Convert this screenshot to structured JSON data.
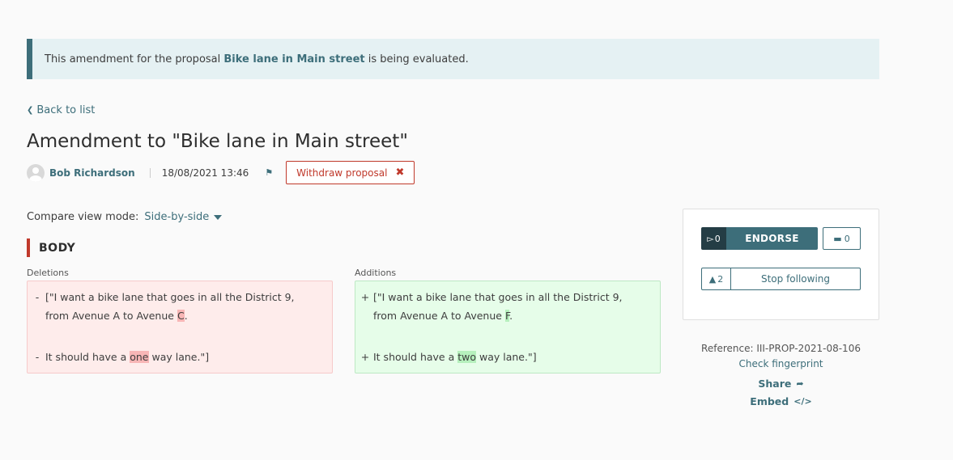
{
  "callout": {
    "prefix": "This amendment for the proposal",
    "proposal_link": "Bike lane in Main street",
    "suffix": "is being evaluated."
  },
  "nav": {
    "back_label": "Back to list"
  },
  "title": "Amendment to \"Bike lane in Main street\"",
  "meta": {
    "author": "Bob Richardson",
    "date": "18/08/2021 13:46",
    "withdraw_label": "Withdraw proposal"
  },
  "compare": {
    "label": "Compare view mode:",
    "selected": "Side-by-side"
  },
  "section": {
    "title": "BODY"
  },
  "diff": {
    "deletions_label": "Deletions",
    "additions_label": "Additions",
    "deletions": [
      {
        "sign": "-",
        "pre": "[\"I want a bike lane that goes in all the District 9, from Avenue A to Avenue ",
        "hl": "C",
        "post": "."
      },
      {
        "sign": "-",
        "pre": "It should have a ",
        "hl": "one",
        "post": " way lane.\"]"
      }
    ],
    "additions": [
      {
        "sign": "+",
        "pre": "[\"I want a bike lane that goes in all the District 9, from Avenue A to Avenue ",
        "hl": "F",
        "post": "."
      },
      {
        "sign": "+",
        "pre": "It should have a ",
        "hl": "two",
        "post": " way lane.\"]"
      }
    ]
  },
  "sidebar": {
    "endorse_count": "0",
    "endorse_label": "ENDORSE",
    "comments_count": "0",
    "followers_count": "2",
    "follow_label": "Stop following",
    "reference": "Reference: III-PROP-2021-08-106",
    "fingerprint_label": "Check fingerprint",
    "share_label": "Share",
    "embed_label": "Embed"
  },
  "colors": {
    "primary": "#3d6e7a",
    "alert": "#c0392b",
    "deletion_bg": "#feeceb",
    "addition_bg": "#e6fde9"
  }
}
